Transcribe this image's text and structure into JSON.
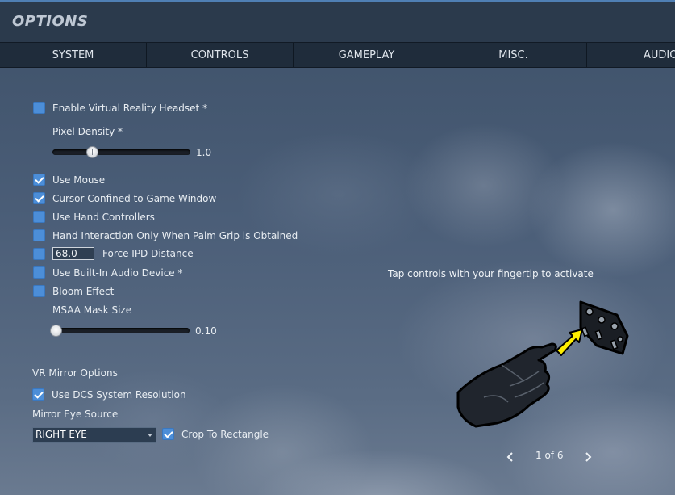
{
  "window": {
    "title": "OPTIONS"
  },
  "tabs": [
    "SYSTEM",
    "CONTROLS",
    "GAMEPLAY",
    "MISC.",
    "AUDIO"
  ],
  "vr": {
    "enable_headset": {
      "label": "Enable Virtual Reality Headset *",
      "checked": false
    },
    "pixel_density": {
      "label": "Pixel Density *",
      "value": "1.0",
      "fraction": 0.27
    },
    "use_mouse": {
      "label": "Use Mouse",
      "checked": true
    },
    "cursor_confined": {
      "label": "Cursor Confined to Game Window",
      "checked": true
    },
    "hand_controllers": {
      "label": "Use Hand Controllers",
      "checked": false
    },
    "palm_grip": {
      "label": "Hand Interaction Only When Palm Grip is Obtained",
      "checked": false
    },
    "force_ipd": {
      "label": "Force IPD Distance",
      "value": "68.0",
      "checked": false
    },
    "audio_device": {
      "label": "Use Built-In Audio Device *",
      "checked": false
    },
    "bloom": {
      "label": "Bloom Effect",
      "checked": false
    },
    "msaa": {
      "label": "MSAA Mask Size",
      "value": "0.10",
      "fraction": 0.0
    },
    "mirror_options_label": "VR Mirror Options",
    "dcs_resolution": {
      "label": "Use DCS System Resolution",
      "checked": true
    },
    "mirror_eye_label": "Mirror Eye Source",
    "mirror_eye_value": "RIGHT EYE",
    "crop": {
      "label": "Crop To Rectangle",
      "checked": true
    }
  },
  "hint": {
    "text": "Tap controls with your fingertip to activate",
    "page": "1 of 6"
  },
  "icons": {
    "prev": "chevron-left-icon",
    "next": "chevron-right-icon",
    "illustration": "gloved-hand-pressing-panel-icon"
  },
  "colors": {
    "checkbox": "#4c8ed8",
    "accent_arrow": "#ffee00",
    "title_bar": "#2b3a4c",
    "tab_bar": "#1f2c3b"
  }
}
